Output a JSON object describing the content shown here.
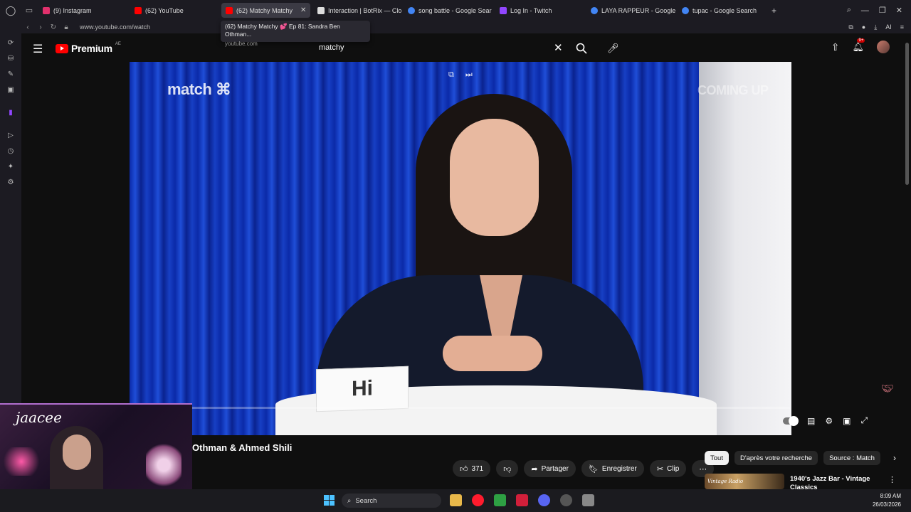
{
  "browser": {
    "tabs": [
      {
        "label": "(9) Instagram",
        "icon": "instagram-icon",
        "color": "#e1306c"
      },
      {
        "label": "(62) YouTube",
        "icon": "youtube-icon",
        "color": "#ff0000"
      },
      {
        "label": "(62) Matchy Matchy",
        "icon": "youtube-icon",
        "color": "#ff0000"
      },
      {
        "label": "Interaction | BotRix — Clo",
        "icon": "botrix-icon",
        "color": "#dddddd"
      },
      {
        "label": "song battle - Google Sear",
        "icon": "google-icon",
        "color": "#4285f4"
      },
      {
        "label": "Log In - Twitch",
        "icon": "twitch-icon",
        "color": "#9146ff"
      },
      {
        "label": "LAYA RAPPEUR - Google S",
        "icon": "google-icon",
        "color": "#4285f4"
      },
      {
        "label": "tupac - Google Search",
        "icon": "google-icon",
        "color": "#4285f4"
      }
    ],
    "new_tab": "+",
    "url": "www.youtube.com/watch",
    "ai_label": "AI",
    "tooltip": {
      "title": "(62) Matchy Matchy 💕 Ep 81: Sandra Ben Othman...",
      "domain": "youtube.com"
    }
  },
  "youtube": {
    "logo_text": "Premium",
    "region": "AE",
    "search_value": "matchy",
    "notification_count": "9+",
    "video": {
      "brand_watermark": "match",
      "coming_up": "COMING UP",
      "name_card": "Hi",
      "progress_fraction": 0.0
    },
    "title": "Othman & Ahmed Shili",
    "actions": {
      "likes": "371",
      "share": "Partager",
      "save": "Enregistrer",
      "clip": "Clip"
    },
    "chips": [
      "Tout",
      "D'après votre recherche",
      "Source : Match"
    ],
    "recommendation": {
      "thumb_text": "Vintage Radio",
      "title": "1940's Jazz Bar - Vintage Classics"
    }
  },
  "webcam": {
    "name": "jaacee"
  },
  "taskbar": {
    "search_label": "Search",
    "time": "8:09 AM",
    "date": "26/03/2026"
  },
  "colors": {
    "accent_red": "#ff0000",
    "background": "#0f0f0f",
    "chip_active": "#f1f1f1"
  }
}
